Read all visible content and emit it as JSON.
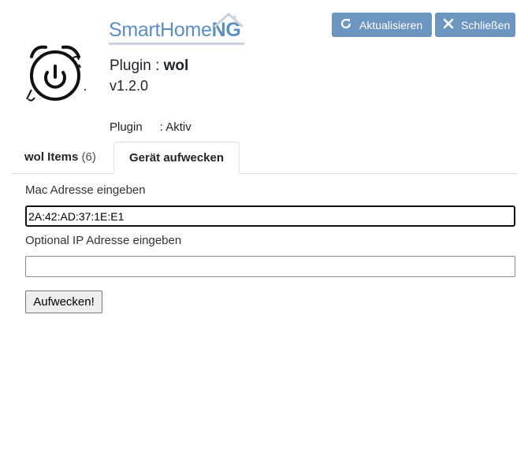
{
  "brand": {
    "name_part1": "SmartHome",
    "name_part2": "NG",
    "logo_icon": "alarm-clock-power-icon"
  },
  "toolbar": {
    "refresh_label": "Aktualisieren",
    "refresh_icon": "refresh-icon",
    "close_label": "Schließen",
    "close_icon": "close-icon"
  },
  "plugin": {
    "title_prefix": "Plugin : ",
    "name": "wol",
    "version": "v1.2.0",
    "status_label": "Plugin",
    "status_value": ": Aktiv"
  },
  "tabs": [
    {
      "label": "wol Items",
      "count": "(6)",
      "active": false
    },
    {
      "label": "Gerät aufwecken",
      "active": true
    }
  ],
  "form": {
    "mac_label": "Mac Adresse eingeben",
    "mac_value": "2A:42:AD:37:1E:E1",
    "ip_label": "Optional IP Adresse eingeben",
    "ip_value": "",
    "wake_button_label": "Aufwecken!"
  },
  "colors": {
    "button_bg": "#6c95c0",
    "brand_blue": "#5b8fc4"
  }
}
